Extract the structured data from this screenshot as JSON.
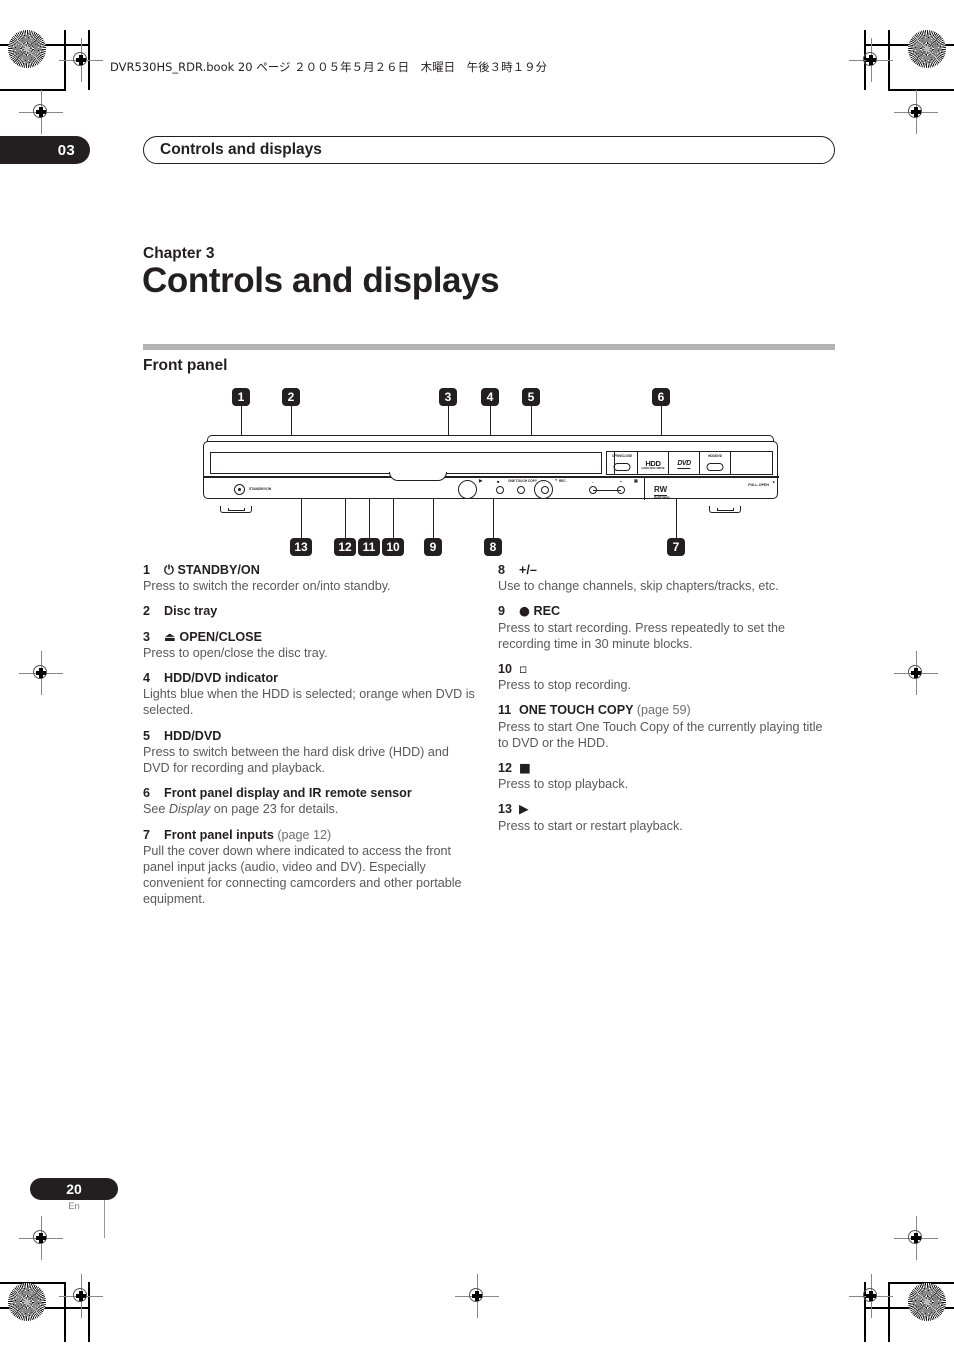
{
  "header": {
    "slug": "DVR530HS_RDR.book  20 ページ  ２００５年５月２６日　木曜日　午後３時１９分",
    "chapter_number": "03",
    "running_head": "Controls and displays"
  },
  "title_block": {
    "chapter_label": "Chapter 3",
    "chapter_title": "Controls and displays"
  },
  "section": {
    "heading": "Front panel"
  },
  "figure": {
    "callouts_top": [
      "1",
      "2",
      "3",
      "4",
      "5",
      "6"
    ],
    "callouts_bottom": [
      "13",
      "12",
      "11",
      "10",
      "9",
      "8",
      "7"
    ],
    "panel_labels": {
      "standby": "STANDBY/ON",
      "open_close": "OPEN/CLOSE",
      "hdd_logo": "HDD",
      "hdd_sub": "HARD DISC DRIVE",
      "dvd_logo": "DVD",
      "dvd_sub": "RECORDABLE",
      "hdd_dvd": "HDD/DVD",
      "one_touch_copy": "ONE TOUCH COPY",
      "rec": "REC",
      "minus": "–",
      "plus": "+",
      "rw_logo": "RW",
      "rw_sub": "ReWritable",
      "pull_open": "PULL-OPEN"
    }
  },
  "items_left": [
    {
      "num": "1",
      "icon": "⏻",
      "label": "STANDBY/ON",
      "page_ref": "",
      "body": "Press to switch the recorder on/into standby."
    },
    {
      "num": "2",
      "icon": "",
      "label": "Disc tray",
      "page_ref": "",
      "body": ""
    },
    {
      "num": "3",
      "icon": "⏏",
      "label": "OPEN/CLOSE",
      "page_ref": "",
      "body": "Press to open/close the disc tray."
    },
    {
      "num": "4",
      "icon": "",
      "label": "HDD/DVD indicator",
      "page_ref": "",
      "body": "Lights blue when the HDD is selected; orange when DVD is selected."
    },
    {
      "num": "5",
      "icon": "",
      "label": "HDD/DVD",
      "page_ref": "",
      "body": "Press to switch between the hard disk drive (HDD) and DVD for recording and playback."
    },
    {
      "num": "6",
      "icon": "",
      "label": "Front panel display and IR remote sensor",
      "page_ref": "",
      "body_pre": "See ",
      "body_italic": "Display",
      "body_post": " on page 23 for details."
    },
    {
      "num": "7",
      "icon": "",
      "label": "Front panel inputs",
      "page_ref": "(page 12)",
      "body": "Pull the cover down where indicated to access the front panel input jacks (audio, video and DV). Especially convenient for connecting camcorders and other portable equipment."
    }
  ],
  "items_right": [
    {
      "num": "8",
      "icon": "",
      "label": "+/–",
      "page_ref": "",
      "body": "Use to change channels, skip chapters/tracks, etc."
    },
    {
      "num": "9",
      "icon": "●",
      "label": "REC",
      "page_ref": "",
      "body": "Press to start recording. Press repeatedly to set the recording time in 30 minute blocks."
    },
    {
      "num": "10",
      "icon": "▫",
      "label": "",
      "page_ref": "",
      "body": "Press to stop recording."
    },
    {
      "num": "11",
      "icon": "",
      "label": "ONE TOUCH COPY",
      "page_ref": "(page 59)",
      "body": "Press to start One Touch Copy of the currently playing title to DVD or the HDD."
    },
    {
      "num": "12",
      "icon": "■",
      "label": "",
      "page_ref": "",
      "body": "Press to stop playback."
    },
    {
      "num": "13",
      "icon": "▶",
      "label": "",
      "page_ref": "",
      "body": "Press to start or restart playback."
    }
  ],
  "footer": {
    "page_number": "20",
    "language_code": "En"
  }
}
